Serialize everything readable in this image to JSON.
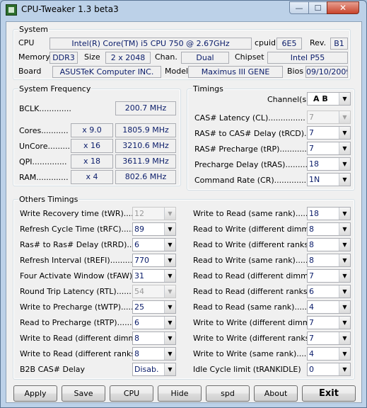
{
  "window": {
    "title": "CPU-Tweaker 1.3 beta3"
  },
  "system": {
    "heading": "System",
    "cpu_label": "CPU",
    "cpu_value": "Intel(R) Core(TM) i5 CPU        750  @ 2.67GHz",
    "cpuid_label": "cpuid",
    "cpuid_value": "6E5",
    "rev_label": "Rev.",
    "rev_value": "B1",
    "memory_label": "Memory",
    "memory_value": "DDR3",
    "size_label": "Size",
    "size_value": "2 x 2048",
    "chan_label": "Chan.",
    "chan_value": "Dual",
    "chipset_label": "Chipset",
    "chipset_value": "Intel P55",
    "board_label": "Board",
    "board_value": "ASUSTeK Computer INC.",
    "model_label": "Model",
    "model_value": "Maximus III GENE",
    "bios_label": "Bios",
    "bios_value": "09/10/2009"
  },
  "frequency": {
    "heading": "System Frequency",
    "bclk_label": "BCLK.............",
    "bclk_value": "200.7 MHz",
    "rows": [
      {
        "label": "Cores...........",
        "mult": "x 9.0",
        "freq": "1805.9 MHz"
      },
      {
        "label": "UnCore..........",
        "mult": "x 16",
        "freq": "3210.6 MHz"
      },
      {
        "label": "QPI..............",
        "mult": "x 18",
        "freq": "3611.9 MHz"
      },
      {
        "label": "RAM.............",
        "mult": "x 4",
        "freq": "802.6 MHz"
      }
    ]
  },
  "timings": {
    "heading": "Timings",
    "channels_label": "Channel(s)",
    "channels_value": "A  B",
    "rows": [
      {
        "label": "CAS# Latency (CL)...............",
        "value": "7",
        "disabled": true
      },
      {
        "label": "RAS# to CAS# Delay (tRCD).......",
        "value": "7",
        "disabled": false
      },
      {
        "label": "RAS# Precharge (tRP)..............",
        "value": "7",
        "disabled": false
      },
      {
        "label": "Precharge Delay (tRAS)............",
        "value": "18",
        "disabled": false
      },
      {
        "label": "Command Rate (CR)................",
        "value": "1N",
        "disabled": false
      }
    ]
  },
  "others": {
    "heading": "Others Timings",
    "left": [
      {
        "label": "Write Recovery time (tWR)..........",
        "value": "12",
        "disabled": true
      },
      {
        "label": "Refresh Cycle Time (tRFC)..........",
        "value": "89",
        "disabled": false
      },
      {
        "label": "Ras# to Ras# Delay (tRRD)..........",
        "value": "6",
        "disabled": false
      },
      {
        "label": "Refresh Interval (tREFI)............",
        "value": "770",
        "disabled": false
      },
      {
        "label": "Four Activate Window (tFAW).......",
        "value": "31",
        "disabled": false
      },
      {
        "label": "Round Trip Latency (RTL)...........",
        "value": "54",
        "disabled": true
      },
      {
        "label": "Write to Precharge (tWTP)..........",
        "value": "25",
        "disabled": false
      },
      {
        "label": "Read to Precharge (tRTP)...........",
        "value": "6",
        "disabled": false
      },
      {
        "label": "Write to Read (different dimms).....",
        "value": "8",
        "disabled": false
      },
      {
        "label": "Write to Read (different ranks).....",
        "value": "8",
        "disabled": false
      },
      {
        "label": "B2B CAS# Delay",
        "value": "Disab.",
        "disabled": false
      }
    ],
    "right": [
      {
        "label": "Write to Read (same rank).............",
        "value": "18",
        "disabled": false
      },
      {
        "label": "Read to Write (different dimms).......",
        "value": "8",
        "disabled": false
      },
      {
        "label": "Read to Write (different ranks)........",
        "value": "8",
        "disabled": false
      },
      {
        "label": "Read to Write (same rank)..............",
        "value": "8",
        "disabled": false
      },
      {
        "label": "Read to Read (different dimms)........",
        "value": "7",
        "disabled": false
      },
      {
        "label": "Read to Read (different ranks)........",
        "value": "6",
        "disabled": false
      },
      {
        "label": "Read to Read (same rank)...............",
        "value": "4",
        "disabled": false
      },
      {
        "label": "Write to Write (different dimms).......",
        "value": "7",
        "disabled": false
      },
      {
        "label": "Write to Write (different ranks).......",
        "value": "7",
        "disabled": false
      },
      {
        "label": "Write to Write (same rank)..............",
        "value": "4",
        "disabled": false
      },
      {
        "label": "Idle Cycle limit (tRANKIDLE)",
        "value": "0",
        "disabled": false
      }
    ]
  },
  "buttons": {
    "apply": "Apply",
    "save": "Save",
    "cpu": "CPU",
    "hide": "Hide",
    "spd": "spd",
    "about": "About",
    "exit": "Exit"
  }
}
